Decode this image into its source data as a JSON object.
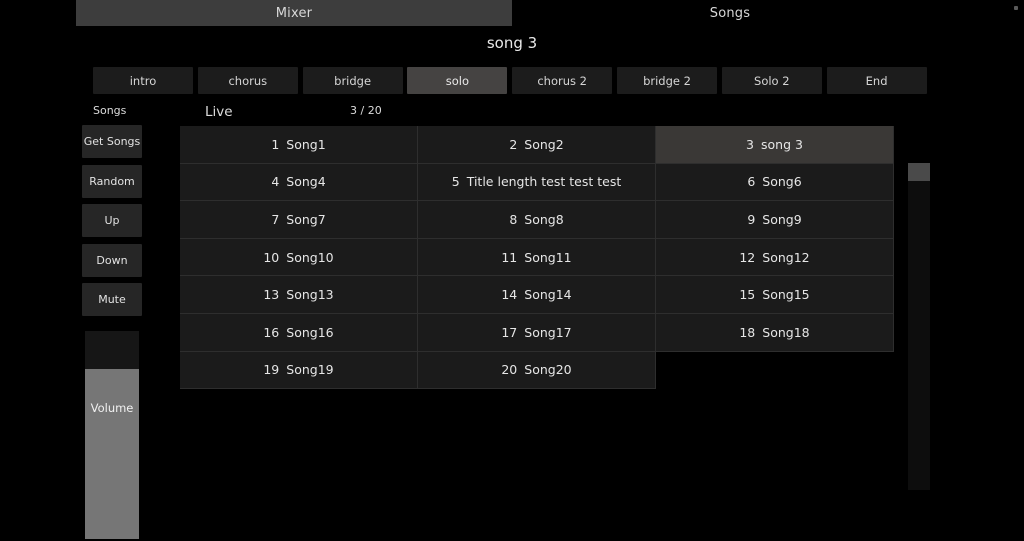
{
  "tabs": [
    {
      "label": "Mixer",
      "active": true
    },
    {
      "label": "Songs",
      "active": false
    }
  ],
  "header": {
    "song_title": "song 3"
  },
  "sections": [
    {
      "label": "intro",
      "active": false
    },
    {
      "label": "chorus",
      "active": false
    },
    {
      "label": "bridge",
      "active": false
    },
    {
      "label": "solo",
      "active": true
    },
    {
      "label": "chorus 2",
      "active": false
    },
    {
      "label": "bridge 2",
      "active": false
    },
    {
      "label": "Solo 2",
      "active": false
    },
    {
      "label": "End",
      "active": false
    }
  ],
  "subheader": {
    "songs_label": "Songs",
    "mode_label": "Live",
    "counter": "3 / 20"
  },
  "sidebar": {
    "buttons": [
      {
        "label": "Get Songs"
      },
      {
        "label": "Random"
      },
      {
        "label": "Up"
      },
      {
        "label": "Down"
      },
      {
        "label": "Mute"
      }
    ],
    "volume": {
      "label": "Volume"
    }
  },
  "songs": [
    {
      "num": "1",
      "name": "Song1",
      "selected": false
    },
    {
      "num": "2",
      "name": "Song2",
      "selected": false
    },
    {
      "num": "3",
      "name": "song 3",
      "selected": true
    },
    {
      "num": "4",
      "name": "Song4",
      "selected": false
    },
    {
      "num": "5",
      "name": "Title length test test test",
      "selected": false
    },
    {
      "num": "6",
      "name": "Song6",
      "selected": false
    },
    {
      "num": "7",
      "name": "Song7",
      "selected": false
    },
    {
      "num": "8",
      "name": "Song8",
      "selected": false
    },
    {
      "num": "9",
      "name": "Song9",
      "selected": false
    },
    {
      "num": "10",
      "name": "Song10",
      "selected": false
    },
    {
      "num": "11",
      "name": "Song11",
      "selected": false
    },
    {
      "num": "12",
      "name": "Song12",
      "selected": false
    },
    {
      "num": "13",
      "name": "Song13",
      "selected": false
    },
    {
      "num": "14",
      "name": "Song14",
      "selected": false
    },
    {
      "num": "15",
      "name": "Song15",
      "selected": false
    },
    {
      "num": "16",
      "name": "Song16",
      "selected": false
    },
    {
      "num": "17",
      "name": "Song17",
      "selected": false
    },
    {
      "num": "18",
      "name": "Song18",
      "selected": false
    },
    {
      "num": "19",
      "name": "Song19",
      "selected": false
    },
    {
      "num": "20",
      "name": "Song20",
      "selected": false
    }
  ],
  "colors": {
    "background": "#000000",
    "tab_active": "#3d3d3d",
    "button": "#1c1c1c",
    "button_active": "#454342",
    "cell": "#1b1b1b",
    "cell_selected": "#3a3836",
    "fader_fill": "#767676",
    "text": "#e6e6e6"
  }
}
